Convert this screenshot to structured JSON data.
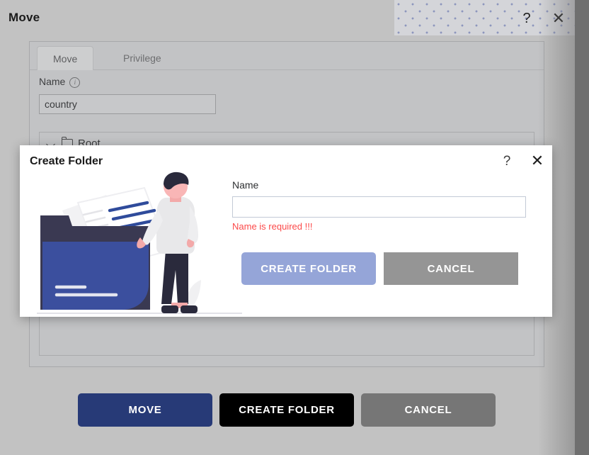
{
  "window": {
    "title": "Move",
    "help_icon": "?",
    "close_icon": "✕"
  },
  "move_dialog": {
    "tabs": [
      {
        "label": "Move",
        "active": true
      },
      {
        "label": "Privilege",
        "active": false
      }
    ],
    "name_label": "Name",
    "info_icon": "i",
    "name_value": "country",
    "tree": {
      "root_label": "Root",
      "expand_icon": "chevron-down-icon",
      "folder_icon": "folder-icon"
    },
    "actions": {
      "move": "MOVE",
      "create_folder": "CREATE FOLDER",
      "cancel": "CANCEL"
    }
  },
  "create_folder_modal": {
    "title": "Create Folder",
    "help_icon": "?",
    "close_icon": "✕",
    "name_label": "Name",
    "name_value": "",
    "name_placeholder": "",
    "error_message": "Name is required !!!",
    "buttons": {
      "create": "CREATE FOLDER",
      "cancel": "CANCEL"
    },
    "illustration_alt": "person-with-folder-illustration"
  },
  "colors": {
    "move_button": "#273a77",
    "create_folder_button_dark": "#000000",
    "cancel_button": "#767676",
    "modal_create_button": "#95a5d8",
    "modal_cancel_button": "#959595",
    "error_text": "#fc4949",
    "folder_blue": "#3b4f9e",
    "backdrop": "#cfd0d4"
  }
}
